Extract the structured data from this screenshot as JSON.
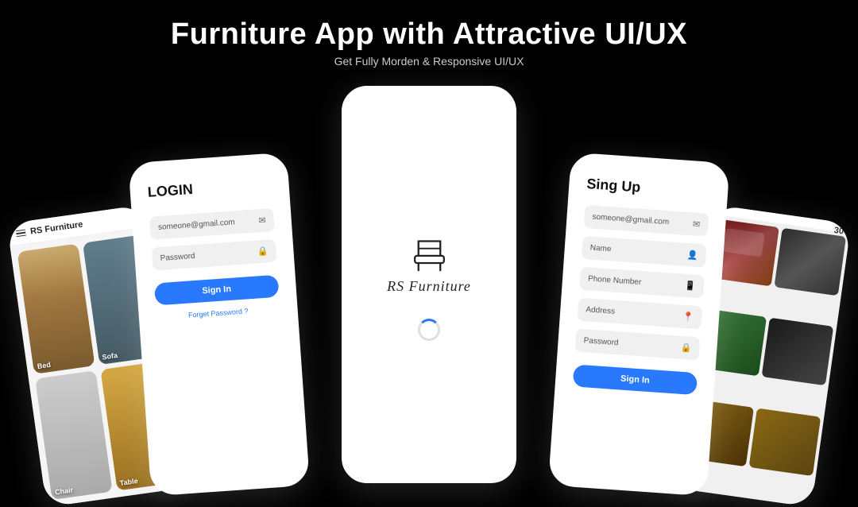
{
  "header": {
    "title": "Furniture App with Attractive UI/UX",
    "subtitle": "Get Fully Morden & Responsive UI/UX"
  },
  "phone_home": {
    "brand": "RS Furniture",
    "cards": [
      {
        "label": "Bed"
      },
      {
        "label": "Sofa"
      },
      {
        "label": "Chair"
      },
      {
        "label": "Table"
      }
    ]
  },
  "phone_login": {
    "title": "LOGIN",
    "email_placeholder": "someone@gmail.com",
    "password_placeholder": "Password",
    "signin_button": "Sign In",
    "forget_password": "Forget Password ?"
  },
  "phone_center": {
    "brand_name": "RS Furniture"
  },
  "phone_signup": {
    "title": "Sing Up",
    "email_placeholder": "someone@gmail.com",
    "name_placeholder": "Name",
    "phone_placeholder": "Phone Number",
    "address_placeholder": "Address",
    "password_placeholder": "Password",
    "signin_button": "Sign In"
  },
  "phone_gallery": {
    "number": "30"
  },
  "icons": {
    "hamburger": "☰",
    "email": "✉",
    "lock": "🔒",
    "person": "👤",
    "phone": "📱",
    "location": "📍"
  }
}
